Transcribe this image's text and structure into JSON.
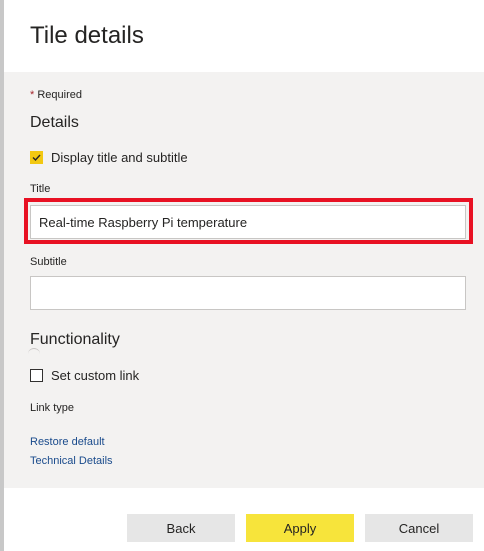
{
  "pane": {
    "title": "Tile details"
  },
  "form": {
    "required_marker": "*",
    "required_text": "Required",
    "details_heading": "Details",
    "display_checkbox": {
      "label": "Display title and subtitle",
      "checked": true
    },
    "title_field": {
      "label": "Title",
      "value": "Real-time Raspberry Pi temperature"
    },
    "subtitle_field": {
      "label": "Subtitle",
      "value": ""
    },
    "functionality_heading": "Functionality",
    "custom_link_checkbox": {
      "label": "Set custom link",
      "checked": false
    },
    "link_type_label": "Link type",
    "restore_default_link": "Restore default",
    "technical_details_link": "Technical Details"
  },
  "footer": {
    "back_label": "Back",
    "apply_label": "Apply",
    "cancel_label": "Cancel"
  },
  "colors": {
    "accent": "#f2c811",
    "apply_button": "#f7e43b",
    "highlight": "#e81123",
    "link": "#1a4b8c",
    "panel_bg": "#f3f2f1"
  }
}
